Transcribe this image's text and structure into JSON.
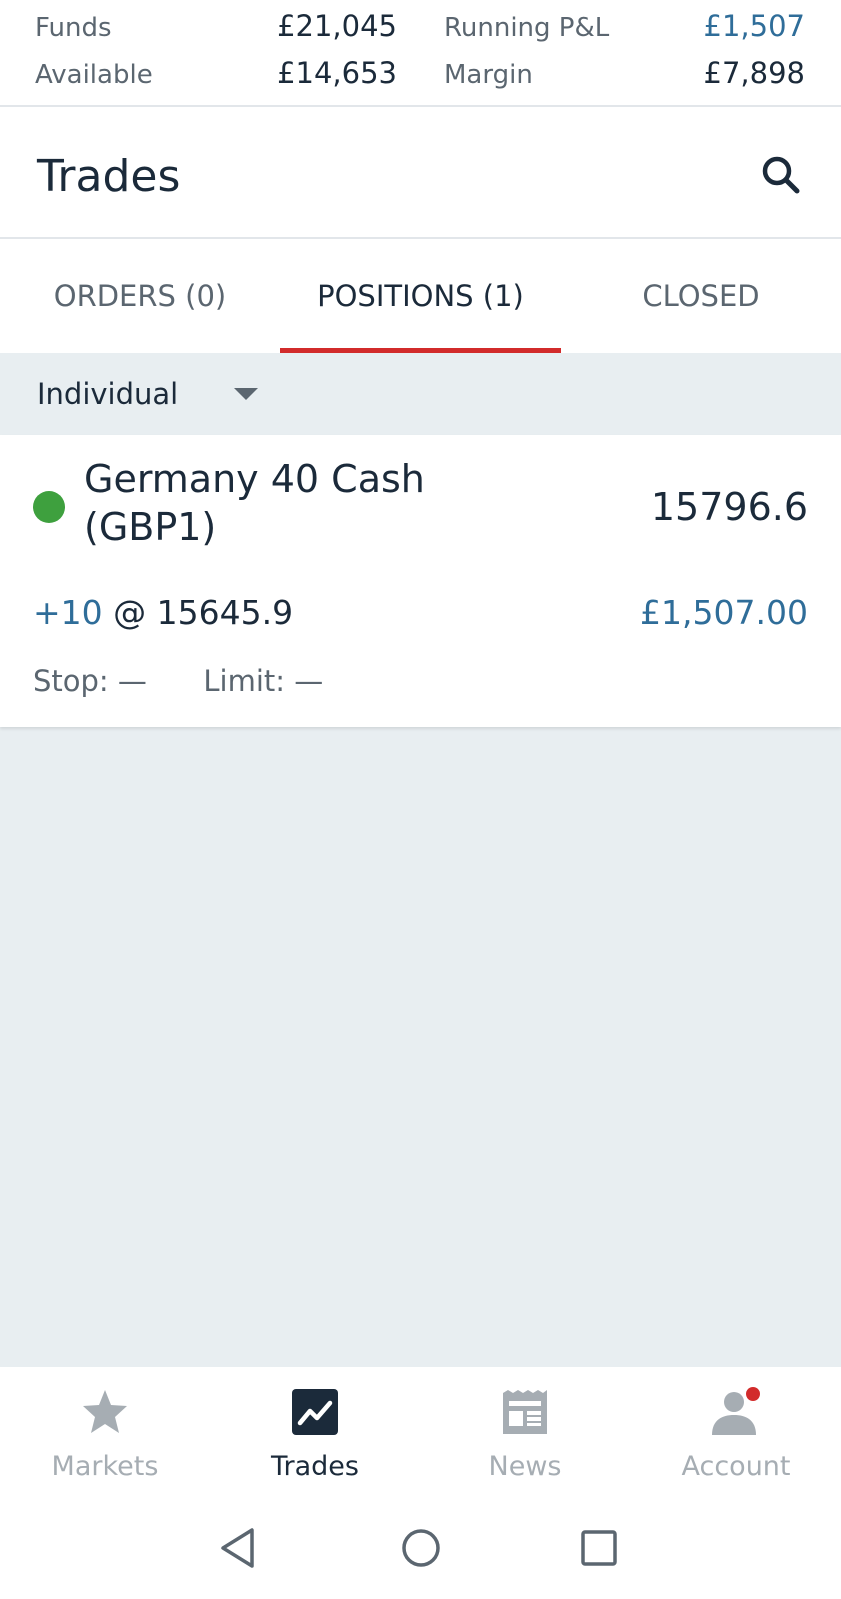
{
  "summary": {
    "funds_label": "Funds",
    "funds_value": "£21,045",
    "available_label": "Available",
    "available_value": "£14,653",
    "running_pl_label": "Running P&L",
    "running_pl_value": "£1,507",
    "margin_label": "Margin",
    "margin_value": "£7,898"
  },
  "header": {
    "title": "Trades",
    "search_icon": "search-icon"
  },
  "tabs": [
    {
      "label": "ORDERS (0)",
      "active": false
    },
    {
      "label": "POSITIONS (1)",
      "active": true
    },
    {
      "label": "CLOSED",
      "active": false
    }
  ],
  "filter": {
    "selected": "Individual",
    "icon": "caret-down-icon"
  },
  "positions": [
    {
      "name": "Germany 40 Cash (GBP1)",
      "level": "15796.6",
      "quantity": "+10",
      "at": "@",
      "open_level": "15645.9",
      "pnl": "£1,507.00",
      "stop_label": "Stop:",
      "stop_value": "—",
      "limit_label": "Limit:",
      "limit_value": "—",
      "status_color": "#3ea03e"
    }
  ],
  "bottom_nav": [
    {
      "label": "Markets",
      "icon": "star-icon",
      "active": false
    },
    {
      "label": "Trades",
      "icon": "trades-chart-icon",
      "active": true
    },
    {
      "label": "News",
      "icon": "newspaper-icon",
      "active": false
    },
    {
      "label": "Account",
      "icon": "account-icon",
      "active": false,
      "notification": true
    }
  ],
  "colors": {
    "accent_red": "#d22b2b",
    "positive_blue": "#2f6d99",
    "text_dark": "#1b2a3a",
    "status_green": "#3ea03e",
    "background": "#e8eef1"
  }
}
